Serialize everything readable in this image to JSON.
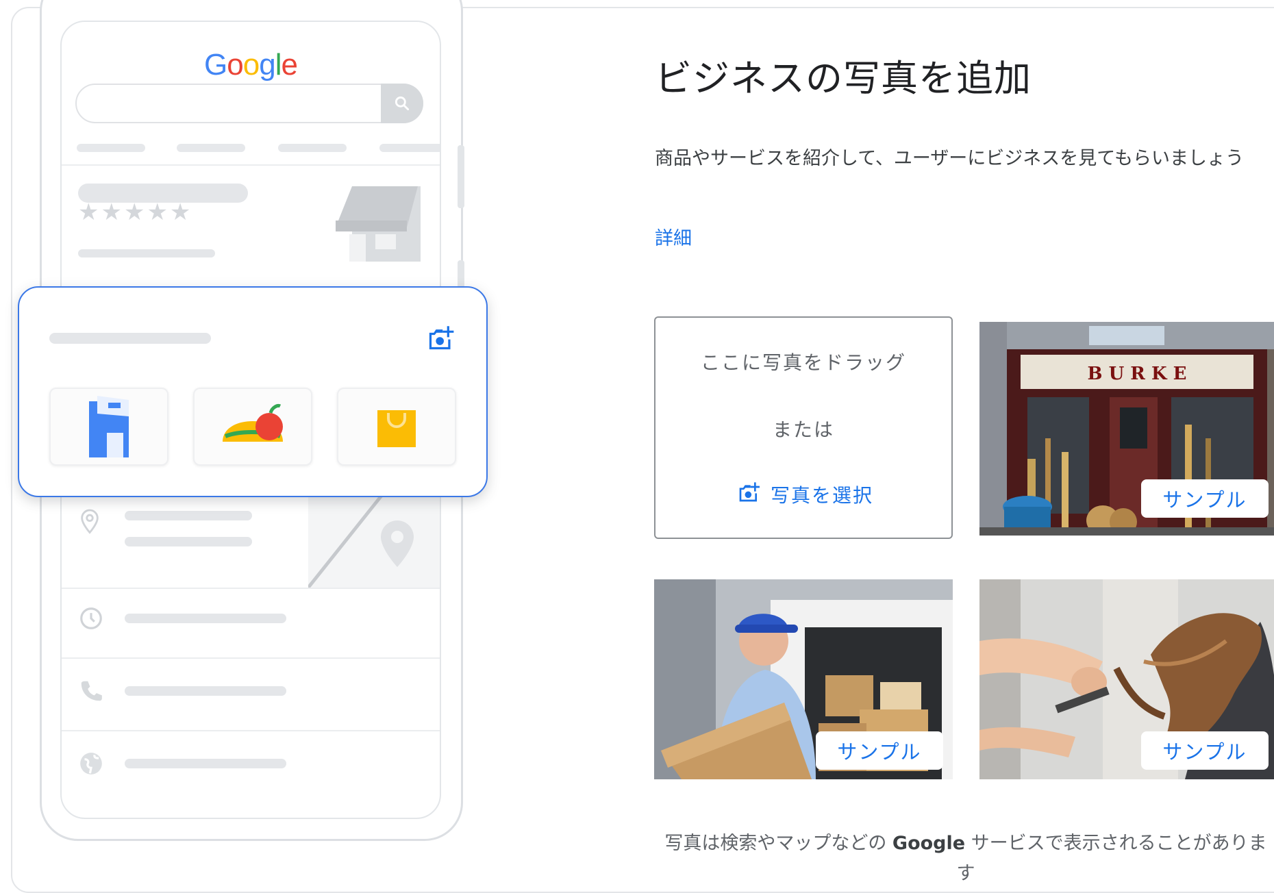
{
  "illustration": {
    "logo_text": "Google",
    "stars": "★★★★★"
  },
  "main": {
    "title": "ビジネスの写真を追加",
    "subtitle": "商品やサービスを紹介して、ユーザーにビジネスを見てもらいましょう",
    "learn_more": "詳細",
    "dropzone": {
      "drag_text": "ここに写真をドラッグ",
      "or_text": "または",
      "select_label": "写真を選択"
    },
    "samples": [
      {
        "badge": "サンプル",
        "sign_text": "B U R K E"
      },
      {
        "badge": "サンプル"
      },
      {
        "badge": "サンプル"
      }
    ],
    "footer_prefix": "写真は検索やマップなどの ",
    "footer_brand": "Google",
    "footer_suffix": " サービスで表示されることがあります"
  },
  "colors": {
    "accent": "#1a73e8",
    "card_border": "#3b78e7"
  }
}
